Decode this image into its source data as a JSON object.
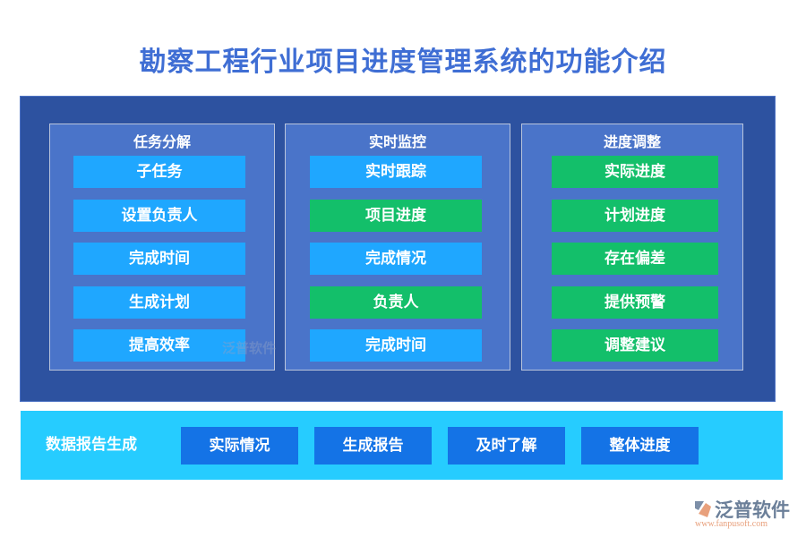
{
  "title": "勘察工程行业项目进度管理系统的功能介绍",
  "colors": {
    "title": "#3f6ed4",
    "panel": "#2d52a0",
    "column": "#4a74c9",
    "blue_item": "#1fa7ff",
    "green_item": "#13bf6a",
    "band": "#26ccff",
    "band_button": "#1473e6"
  },
  "columns": [
    {
      "title": "任务分解",
      "items": [
        {
          "label": "子任务",
          "color": "blue"
        },
        {
          "label": "设置负责人",
          "color": "blue"
        },
        {
          "label": "完成时间",
          "color": "blue"
        },
        {
          "label": "生成计划",
          "color": "blue"
        },
        {
          "label": "提高效率",
          "color": "blue"
        }
      ]
    },
    {
      "title": "实时监控",
      "items": [
        {
          "label": "实时跟踪",
          "color": "blue"
        },
        {
          "label": "项目进度",
          "color": "green"
        },
        {
          "label": "完成情况",
          "color": "blue"
        },
        {
          "label": "负责人",
          "color": "green"
        },
        {
          "label": "完成时间",
          "color": "blue"
        }
      ]
    },
    {
      "title": "进度调整",
      "items": [
        {
          "label": "实际进度",
          "color": "green"
        },
        {
          "label": "计划进度",
          "color": "green"
        },
        {
          "label": "存在偏差",
          "color": "green"
        },
        {
          "label": "提供预警",
          "color": "green"
        },
        {
          "label": "调整建议",
          "color": "green"
        }
      ]
    }
  ],
  "report": {
    "label": "数据报告生成",
    "buttons": [
      "实际情况",
      "生成报告",
      "及时了解",
      "整体进度"
    ]
  },
  "watermark": "泛普软件",
  "logo": {
    "name": "泛普软件",
    "url": "www.fanpusoft.com"
  }
}
